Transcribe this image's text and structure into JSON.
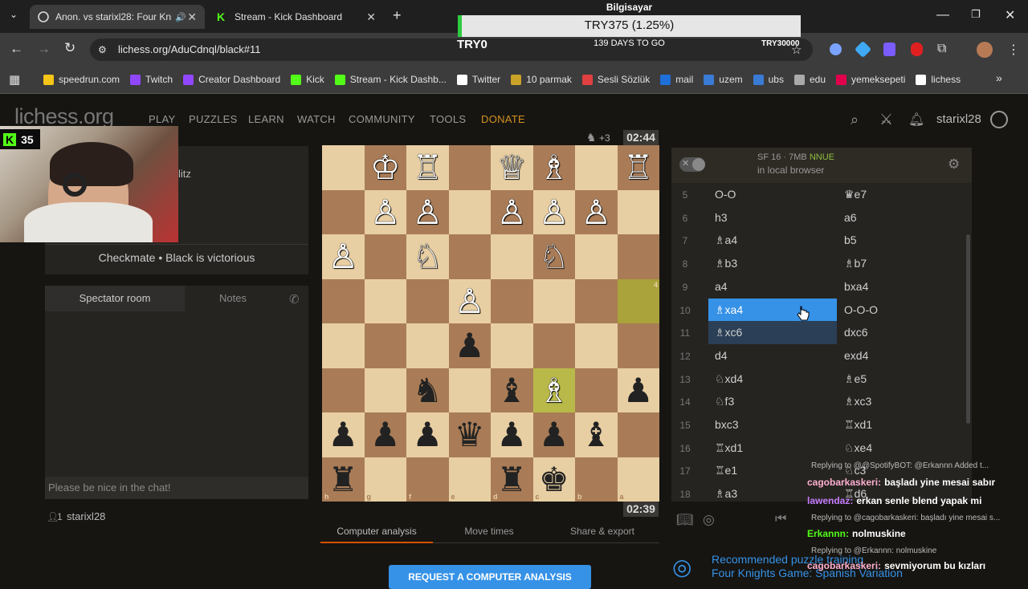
{
  "browser": {
    "tabs": [
      {
        "title": "Anon. vs starixl28: Four Knig",
        "active": true
      },
      {
        "title": "Stream - Kick Dashboard",
        "active": false
      }
    ],
    "url": "lichess.org/AduCdnql/black#11",
    "bookmarks": [
      {
        "label": "speedrun.com",
        "color": "#f5c518"
      },
      {
        "label": "Twitch",
        "color": "#9146ff"
      },
      {
        "label": "Creator Dashboard",
        "color": "#9146ff"
      },
      {
        "label": "Kick",
        "color": "#53fc18"
      },
      {
        "label": "Stream - Kick Dashb...",
        "color": "#53fc18"
      },
      {
        "label": "Twitter",
        "color": "#ffffff"
      },
      {
        "label": "10 parmak",
        "color": "#c9a227"
      },
      {
        "label": "Sesli Sözlük",
        "color": "#e04040"
      },
      {
        "label": "mail",
        "color": "#1e6fd9"
      },
      {
        "label": "uzem",
        "color": "#3a7bd5"
      },
      {
        "label": "ubs",
        "color": "#3a7bd5"
      },
      {
        "label": "edu",
        "color": "#aaaaaa"
      },
      {
        "label": "yemeksepeti",
        "color": "#e0004d"
      },
      {
        "label": "lichess",
        "color": "#ffffff"
      }
    ]
  },
  "overlay": {
    "computer_name": "Bilgisayar",
    "goal_text": "TRY375 (1.25%)",
    "goal_progress_percent": 1.25,
    "goal_start": "TRY0",
    "days_left": "139 DAYS TO GO",
    "goal_target": "TRY30000",
    "kick_viewers": "35"
  },
  "site": {
    "logo": "lichess.org",
    "nav": [
      "PLAY",
      "PUZZLES",
      "LEARN",
      "WATCH",
      "COMMUNITY",
      "TOOLS",
      "DONATE"
    ],
    "username": "starixl28"
  },
  "game": {
    "type_fragment": "litz",
    "result": "Checkmate • Black is victorious",
    "chat_tabs": [
      "Spectator room",
      "Notes"
    ],
    "chat_placeholder": "Please be nice in the chat!",
    "spectators": "1",
    "spectator_name": "starixl28",
    "top_clock": "02:44",
    "bottom_clock": "02:39",
    "material_diff": "+3",
    "analysis_tabs": [
      "Computer analysis",
      "Move times",
      "Share & export"
    ],
    "request_button": "REQUEST A COMPUTER ANALYSIS",
    "files_bottom": [
      "h",
      "g",
      "f",
      "e",
      "d",
      "c",
      "b",
      "a"
    ],
    "ranks_right": [
      "1",
      "2",
      "3",
      "4",
      "5",
      "6",
      "7",
      "8"
    ]
  },
  "engine": {
    "name": "SF 16 · 7MB",
    "badge": "NNUE",
    "location": "in local browser"
  },
  "moves": [
    {
      "n": "5",
      "w": "O-O",
      "b": "♛e7"
    },
    {
      "n": "6",
      "w": "h3",
      "b": "a6"
    },
    {
      "n": "7",
      "w": "♗a4",
      "b": "b5"
    },
    {
      "n": "8",
      "w": "♗b3",
      "b": "♗b7"
    },
    {
      "n": "9",
      "w": "a4",
      "b": "bxa4"
    },
    {
      "n": "10",
      "w": "♗xa4",
      "b": "O-O-O"
    },
    {
      "n": "11",
      "w": "♗xc6",
      "b": "dxc6"
    },
    {
      "n": "12",
      "w": "d4",
      "b": "exd4"
    },
    {
      "n": "13",
      "w": "♘xd4",
      "b": "♗e5"
    },
    {
      "n": "14",
      "w": "♘f3",
      "b": "♗xc3"
    },
    {
      "n": "15",
      "w": "bxc3",
      "b": "♖xd1"
    },
    {
      "n": "16",
      "w": "♖xd1",
      "b": "♘xe4"
    },
    {
      "n": "17",
      "w": "♖e1",
      "b": "♘c3"
    },
    {
      "n": "18",
      "w": "♗a3",
      "b": "♖d6"
    }
  ],
  "puzzle": {
    "heading": "Recommended puzzle training",
    "subtitle": "Four Knights Game: Spanish Variation"
  },
  "chat_overlay": [
    {
      "reply": "Replying to @@SpotifyBOT: @Erkannn  Added t..."
    },
    {
      "user": "cagobarkaskeri:",
      "user_color": "#ffb0d0",
      "text": "başladı yine mesai sabır"
    },
    {
      "user": "lawendaz:",
      "user_color": "#c77dff",
      "text": "erkan senle blend yapak mi"
    },
    {
      "reply": "Replying to @cagobarkaskeri: başladı yine mesai s..."
    },
    {
      "user": "Erkannn:",
      "user_color": "#53fc18",
      "text": "nolmuskine"
    },
    {
      "reply": "Replying to @Erkannn: nolmuskine"
    },
    {
      "user": "cagobarkaskeri:",
      "user_color": "#ffb0d0",
      "text": "sevmiyorum bu kızları"
    }
  ],
  "colors": {
    "accent_blue": "#3692e7",
    "donate": "#d59120",
    "board_light": "#e8cfa3",
    "board_dark": "#a97c57",
    "highlight": "#cdd26a"
  }
}
